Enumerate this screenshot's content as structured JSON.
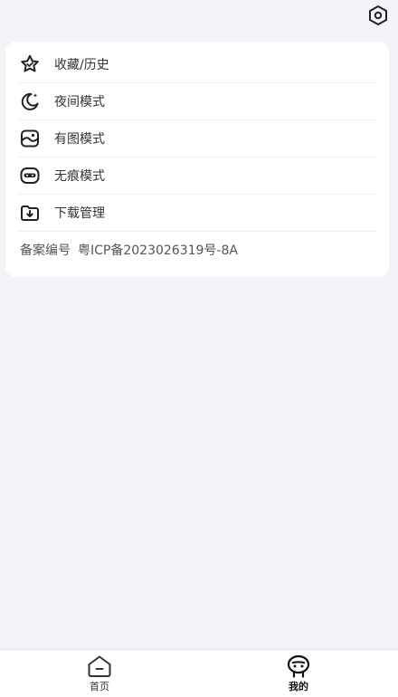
{
  "header": {
    "settings_icon": "settings-hex-icon"
  },
  "menu": {
    "items": [
      {
        "label": "收藏/历史",
        "icon": "star-icon"
      },
      {
        "label": "夜间模式",
        "icon": "moon-icon"
      },
      {
        "label": "有图模式",
        "icon": "image-icon"
      },
      {
        "label": "无痕模式",
        "icon": "mask-icon"
      },
      {
        "label": "下载管理",
        "icon": "download-folder-icon"
      }
    ]
  },
  "icp": {
    "label": "备案编号",
    "value": "粤ICP备2023026319号-8A"
  },
  "tabbar": {
    "tabs": [
      {
        "label": "首页",
        "icon": "home-icon",
        "active": false
      },
      {
        "label": "我的",
        "icon": "profile-icon",
        "active": true
      }
    ]
  }
}
